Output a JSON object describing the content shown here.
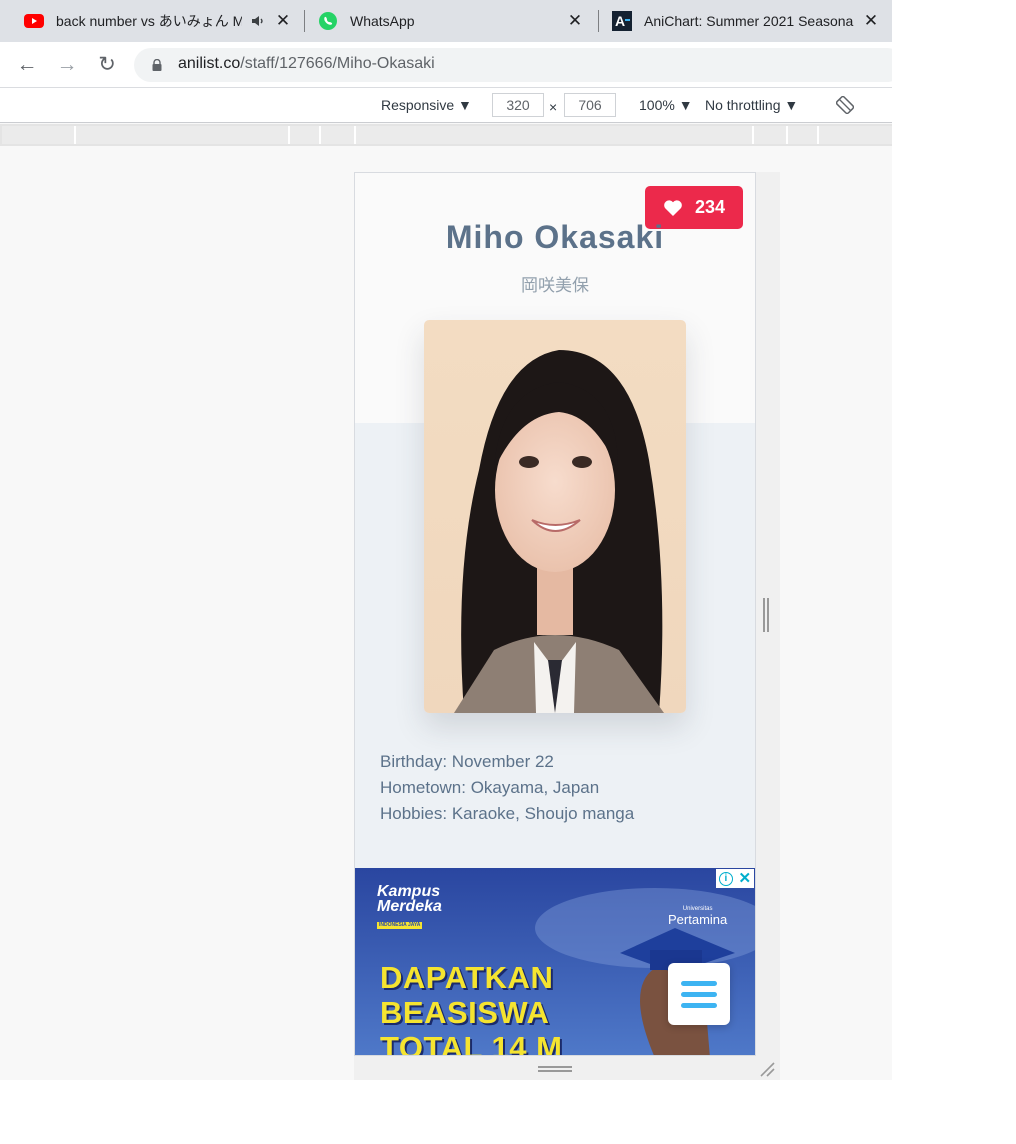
{
  "tabs": [
    {
      "title": "back number vs あいみょん M",
      "icon": "youtube-icon",
      "audio": true
    },
    {
      "title": "WhatsApp",
      "icon": "whatsapp-icon"
    },
    {
      "title": "AniChart: Summer 2021 Seasona",
      "icon": "anichart-icon",
      "icon_text": "A"
    }
  ],
  "address": {
    "domain": "anilist.co",
    "path": "/staff/127666/Miho-Okasaki"
  },
  "device_toolbar": {
    "device": "Responsive ▼",
    "width": "320",
    "times": "×",
    "height": "706",
    "zoom": "100% ▼",
    "throttling": "No throttling ▼"
  },
  "staff": {
    "name": "Miho Okasaki",
    "native_name": "岡咲美保",
    "favourites": "234",
    "bio": [
      "Birthday: November 22",
      "Hometown: Okayama, Japan",
      "Hobbies: Karaoke, Shoujo manga"
    ]
  },
  "ad": {
    "brand_line1": "Kampus",
    "brand_line2": "Merdeka",
    "brand_tag": "INDONESIA JAYA",
    "university_line1": "Universitas",
    "university_line2": "Pertamina",
    "headline": [
      "DAPATKAN",
      "BEASISWA",
      "TOTAL 14 M"
    ]
  },
  "colors": {
    "accent_red": "#ec294b",
    "name_text": "#5c728a",
    "menu_blue": "#3db4f2",
    "ad_headline": "#f5e430"
  }
}
